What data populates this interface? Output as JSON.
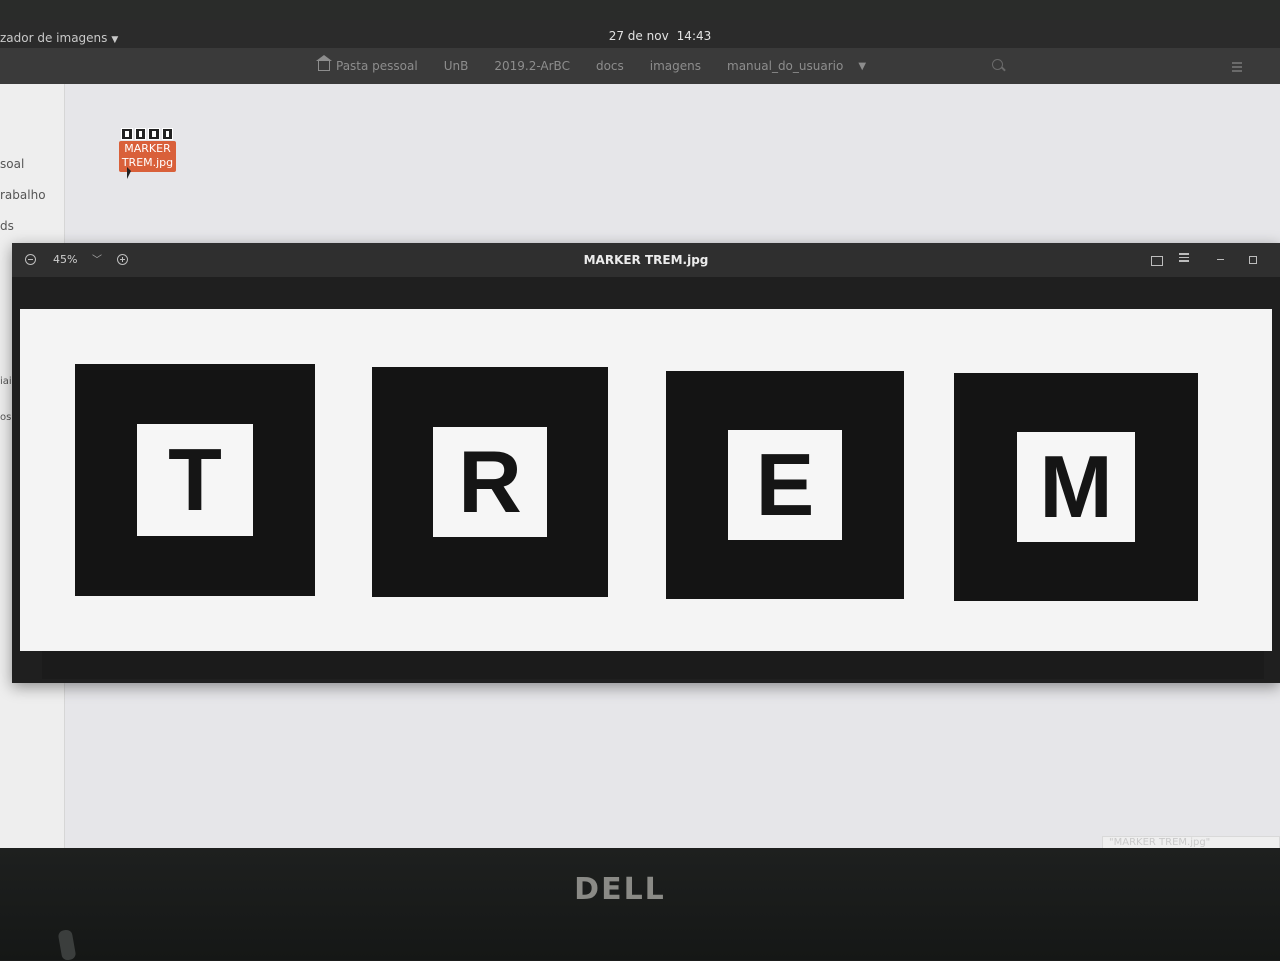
{
  "system": {
    "app_menu": "zador de imagens",
    "clock_date": "27 de nov",
    "clock_time": "14:43"
  },
  "file_manager": {
    "path": [
      "Pasta pessoal",
      "UnB",
      "2019.2-ArBC",
      "docs",
      "imagens",
      "manual_do_usuario"
    ],
    "sidebar": [
      "soal",
      "rabalho",
      "ds",
      "iais",
      "os loc"
    ],
    "file": {
      "name_line1": "MARKER",
      "name_line2": "TREM.jpg"
    },
    "status": "\"MARKER TREM.jpg\" selecionado"
  },
  "viewer": {
    "title": "MARKER TREM.jpg",
    "zoom": "45%",
    "image_letters": [
      "T",
      "R",
      "E",
      "M"
    ]
  },
  "bezel": {
    "brand": "DELL"
  }
}
